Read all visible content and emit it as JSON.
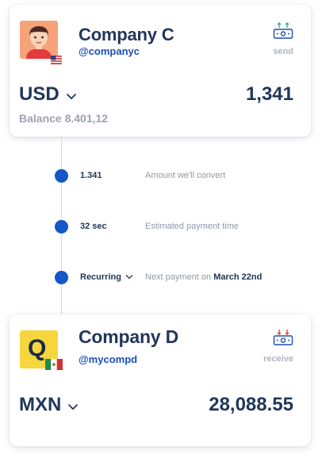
{
  "sender": {
    "company_name": "Company C",
    "handle": "@companyc",
    "action_label": "send",
    "currency": "USD",
    "amount": "1,341",
    "balance": "Balance 8.401,12",
    "avatar_icon": "person-avatar-icon",
    "flag_icon": "us-flag-icon"
  },
  "steps": [
    {
      "value": "1.341",
      "description": "Amount we'll convert"
    },
    {
      "value": "32 sec",
      "description": "Estimated payment time"
    },
    {
      "value": "Recurring",
      "description_prefix": "Next payment on",
      "description_highlight": "March 22nd"
    }
  ],
  "receiver": {
    "company_name": "Company D",
    "handle": "@mycompd",
    "action_label": "receive",
    "currency": "MXN",
    "amount": "28,088.55",
    "logo_letter": "Q",
    "flag_icon": "mx-flag-icon"
  },
  "colors": {
    "accent_blue": "#1357c9",
    "navy_text": "#22365a",
    "muted_text": "#8f98a8",
    "logo_yellow": "#f5d63d"
  }
}
